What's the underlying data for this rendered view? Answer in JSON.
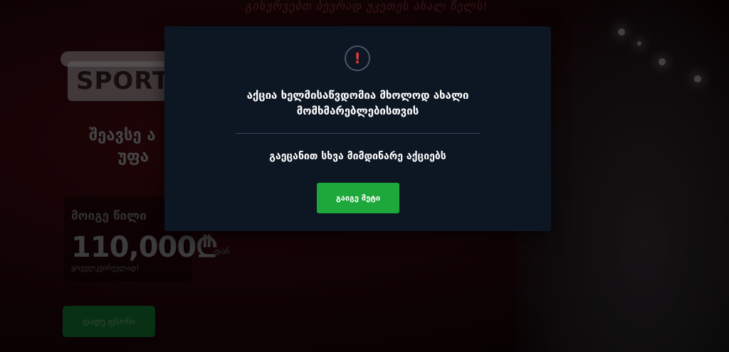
{
  "background": {
    "banner_text": "გისურვებთ ბევრად უკეთეს ახალ წელს!",
    "logo_text": "SPORT",
    "hero_line_1": "შეავსე ა",
    "hero_line_2": "უფა",
    "prize_label": "მოიგე წილი",
    "prize_amount": "110,000₾",
    "prize_suffix": "-დან",
    "prize_note": "ყოველკვირეულად!",
    "cta_label": "დადე ფსონი"
  },
  "modal": {
    "icon": "alert-icon",
    "icon_glyph": "!",
    "title": "აქცია ხელმისაწვდომია მხოლოდ ახალი მომხმარებლებისთვის",
    "subtitle": "გაეცანით სხვა მიმდინარე აქციებს",
    "button_label": "გაიგე მეტი"
  },
  "colors": {
    "modal_bg": "#0d1623",
    "button": "#1ea83b",
    "alert": "#e23a3a"
  }
}
